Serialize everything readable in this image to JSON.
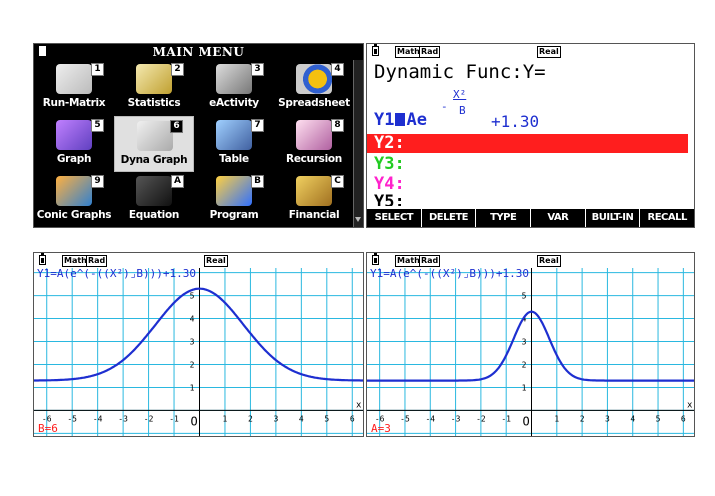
{
  "main_menu": {
    "title": "MAIN MENU",
    "items": [
      {
        "label": "Run-Matrix",
        "key": "1",
        "icon": "run-matrix-icon"
      },
      {
        "label": "Statistics",
        "key": "2",
        "icon": "statistics-icon"
      },
      {
        "label": "eActivity",
        "key": "3",
        "icon": "eactivity-icon"
      },
      {
        "label": "Spreadsheet",
        "key": "4",
        "icon": "spreadsheet-icon"
      },
      {
        "label": "Graph",
        "key": "5",
        "icon": "graph-icon"
      },
      {
        "label": "Dyna Graph",
        "key": "6",
        "icon": "dyna-graph-icon",
        "selected": true
      },
      {
        "label": "Table",
        "key": "7",
        "icon": "table-icon"
      },
      {
        "label": "Recursion",
        "key": "8",
        "icon": "recursion-icon"
      },
      {
        "label": "Conic Graphs",
        "key": "9",
        "icon": "conic-graphs-icon"
      },
      {
        "label": "Equation",
        "key": "A",
        "icon": "equation-icon"
      },
      {
        "label": "Program",
        "key": "B",
        "icon": "program-icon"
      },
      {
        "label": "Financial",
        "key": "C",
        "icon": "financial-icon"
      }
    ]
  },
  "status": {
    "math": "Math",
    "rad": "Rad",
    "real": "Real"
  },
  "dyna_func": {
    "title": "Dynamic Func:Y=",
    "y1_label": "Y1",
    "y1_base": "Ae",
    "y1_exp_num": "X²",
    "y1_exp_den": "B",
    "y1_tail": "+1.30",
    "y2": "Y2:",
    "y3": "Y3:",
    "y4": "Y4:",
    "y5": "Y5:",
    "fkeys": [
      "SELECT",
      "DELETE",
      "TYPE",
      "VAR",
      "BUILT-IN",
      "RECALL"
    ]
  },
  "graphs": [
    {
      "expr": "Y1=A(e^(-((X²)⌟B)))+1.30",
      "param": "B=6",
      "A": 4,
      "B": 6,
      "C": 1.3
    },
    {
      "expr": "Y1=A(e^(-((X²)⌟B)))+1.30",
      "param": "A=3",
      "A": 3,
      "B": 1,
      "C": 1.3
    }
  ],
  "axis": {
    "x_ticks": [
      "-6",
      "-5",
      "-4",
      "-3",
      "-2",
      "-1",
      "1",
      "2",
      "3",
      "4",
      "5",
      "6"
    ],
    "y_ticks": [
      "1",
      "2",
      "3",
      "4",
      "5"
    ],
    "origin": "O",
    "x_label": "x",
    "xlim": [
      -6.5,
      6.5
    ],
    "ylim": [
      -1.2,
      6.2
    ]
  },
  "colors": {
    "curve": "#1e2fd0",
    "grid": "#2ab8e0",
    "selected_row": "#ff1e1e",
    "y3": "#22cc22",
    "y4": "#ff22cc"
  }
}
